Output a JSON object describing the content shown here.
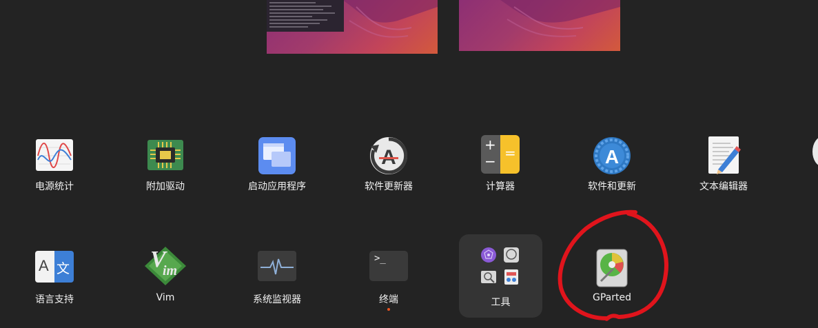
{
  "apps": [
    {
      "id": "power-stats",
      "label": "电源统计"
    },
    {
      "id": "additional-drivers",
      "label": "附加驱动"
    },
    {
      "id": "startup-apps",
      "label": "启动应用程序"
    },
    {
      "id": "software-updater",
      "label": "软件更新器"
    },
    {
      "id": "calculator",
      "label": "计算器"
    },
    {
      "id": "software-updates",
      "label": "软件和更新"
    },
    {
      "id": "text-editor",
      "label": "文本编辑器"
    },
    {
      "id": "language-support",
      "label": "语言支持"
    },
    {
      "id": "vim",
      "label": "Vim"
    },
    {
      "id": "system-monitor",
      "label": "系统监视器"
    },
    {
      "id": "terminal",
      "label": "终端",
      "running": true
    },
    {
      "id": "tools-folder",
      "label": "工具"
    },
    {
      "id": "gparted",
      "label": "GParted"
    }
  ],
  "icons": {
    "language_a": "A",
    "language_wen": "文",
    "vim_v": "V",
    "vim_im": "im",
    "terminal_prompt": ">_",
    "calculator_plus": "+",
    "calculator_minus": "−",
    "calculator_equals": "="
  },
  "colors": {
    "background": "#232323",
    "accent": "#e95420",
    "annotation": "#e0141c"
  },
  "annotation": {
    "type": "hand-drawn-circle",
    "target": "gparted"
  }
}
